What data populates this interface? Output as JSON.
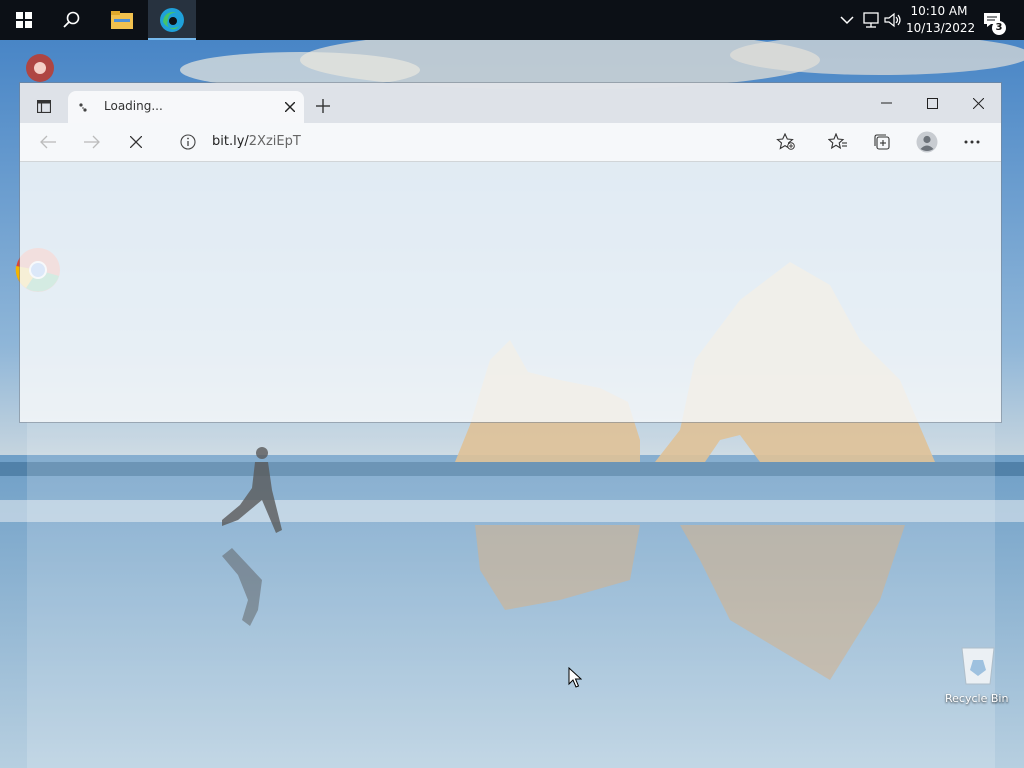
{
  "taskbar": {
    "clock_time": "10:10 AM",
    "clock_date": "10/13/2022",
    "notification_count": "3"
  },
  "desktop": {
    "recycle_bin_label": "Recycle Bin"
  },
  "browser": {
    "tab_title": "Loading...",
    "url_host": "bit.ly/",
    "url_path": "2XziEpT"
  },
  "colors": {
    "taskbar_bg": "#0c1016",
    "accent": "#76b9ed"
  },
  "icons": {
    "start": "windows-start-icon",
    "search": "search-icon",
    "explorer": "file-explorer-icon",
    "edge": "edge-icon",
    "tray_chevron": "chevron-up-icon",
    "network": "network-icon",
    "volume": "volume-icon",
    "notifications": "action-center-icon"
  }
}
